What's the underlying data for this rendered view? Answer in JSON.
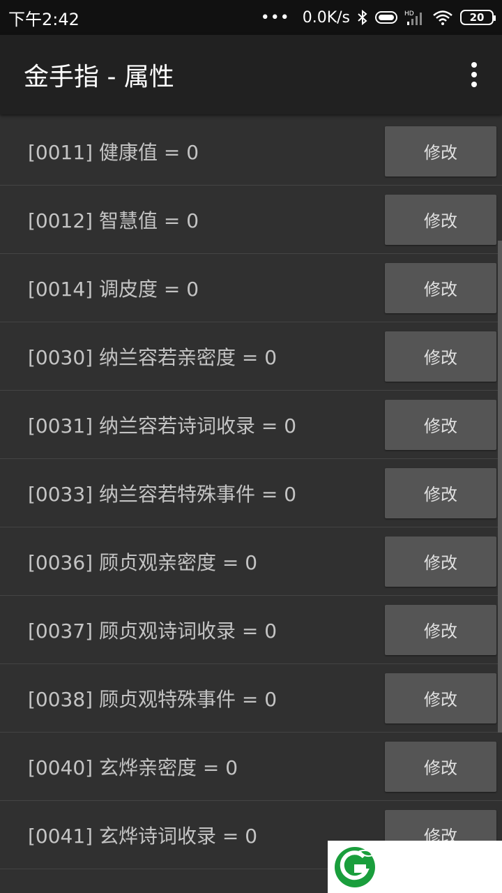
{
  "status_bar": {
    "time": "下午2:42",
    "dots": "•••",
    "network_speed": "0.0K/s",
    "battery_level": "20",
    "hd_label": "HD"
  },
  "app_bar": {
    "title": "金手指 - 属性",
    "overflow_icon": "more-vert-icon"
  },
  "colors": {
    "background": "#303030",
    "app_bar": "#212121",
    "status_bar": "#111111",
    "button": "#555555",
    "watermark_green": "#1a9e3c"
  },
  "rows": [
    {
      "label": "[0011] 健康值 = 0",
      "button": "修改"
    },
    {
      "label": "[0012] 智慧值 = 0",
      "button": "修改"
    },
    {
      "label": "[0014] 调皮度 = 0",
      "button": "修改"
    },
    {
      "label": "[0030] 纳兰容若亲密度 = 0",
      "button": "修改"
    },
    {
      "label": "[0031] 纳兰容若诗词收录 = 0",
      "button": "修改"
    },
    {
      "label": "[0033] 纳兰容若特殊事件 = 0",
      "button": "修改"
    },
    {
      "label": "[0036] 顾贞观亲密度 = 0",
      "button": "修改"
    },
    {
      "label": "[0037] 顾贞观诗词收录 = 0",
      "button": "修改"
    },
    {
      "label": "[0038] 顾贞观特殊事件 = 0",
      "button": "修改"
    },
    {
      "label": "[0040] 玄烨亲密度 = 0",
      "button": "修改"
    },
    {
      "label": "[0041] 玄烨诗词收录 = 0",
      "button": "修改"
    },
    {
      "label": "",
      "button": ""
    }
  ]
}
